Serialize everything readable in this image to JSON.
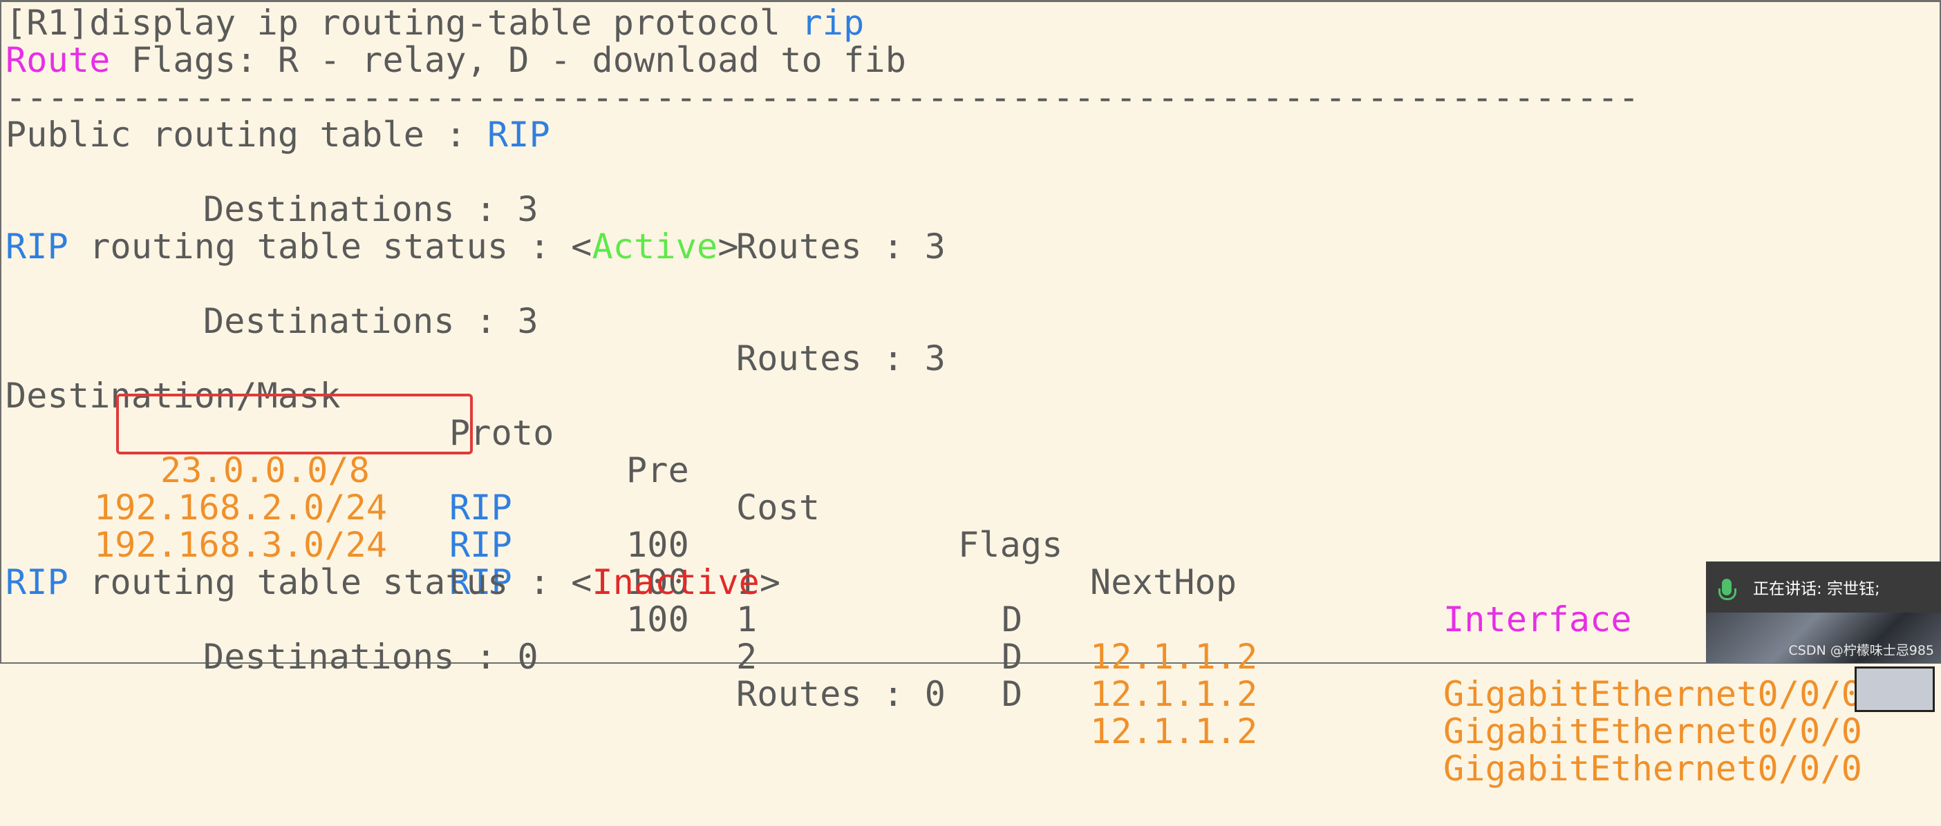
{
  "command": {
    "prompt": "[R1]display ip routing-table protocol ",
    "keyword": "rip"
  },
  "flags_line": {
    "word": "Route",
    "rest": " Flags: R - relay, D - download to fib"
  },
  "separator": "------------------------------------------------------------------------------",
  "public_table": {
    "label": "Public routing table : ",
    "protocol": "RIP",
    "destinations_label": "Destinations : ",
    "destinations": "3",
    "routes_label": "Routes : ",
    "routes": "3"
  },
  "active_status": {
    "rip": "RIP",
    "label": " routing table status : <",
    "state": "Active",
    "close": ">",
    "destinations_label": "Destinations : ",
    "destinations": "3",
    "routes_label": "Routes : ",
    "routes": "3"
  },
  "table": {
    "headers": {
      "dest": "Destination/Mask",
      "proto": "Proto",
      "pre": "Pre",
      "cost": "Cost",
      "flags": "Flags",
      "nexthop": "NextHop",
      "interface": "Interface"
    },
    "rows": [
      {
        "dest": "23.0.0.0/8",
        "proto": "RIP",
        "pre": "100",
        "cost": "1",
        "flags": "D",
        "nexthop": "12.1.1.2",
        "interface": "GigabitEthernet0/0/0"
      },
      {
        "dest": "192.168.2.0/24",
        "proto": "RIP",
        "pre": "100",
        "cost": "1",
        "flags": "D",
        "nexthop": "12.1.1.2",
        "interface": "GigabitEthernet0/0/0"
      },
      {
        "dest": "192.168.3.0/24",
        "proto": "RIP",
        "pre": "100",
        "cost": "2",
        "flags": "D",
        "nexthop": "12.1.1.2",
        "interface": "GigabitEthernet0/0/0"
      }
    ]
  },
  "inactive_status": {
    "rip": "RIP",
    "label": " routing table status : <",
    "state": "Inactive",
    "close": ">",
    "destinations_label": "Destinations : ",
    "destinations": "0",
    "routes_label": "Routes : ",
    "routes": "0"
  },
  "meeting_overlay": {
    "speaking": "正在讲话: 宗世钰;",
    "watermark": "CSDN @柠檬味士忌985"
  },
  "colors": {
    "background": "#fcf5e3",
    "text": "#5a5a5a",
    "blue": "#2f7fe0",
    "magenta": "#e62fe6",
    "green": "#5ee84a",
    "red": "#e02a2a",
    "orange": "#f0902a",
    "highlight_box": "#e03a3a"
  }
}
